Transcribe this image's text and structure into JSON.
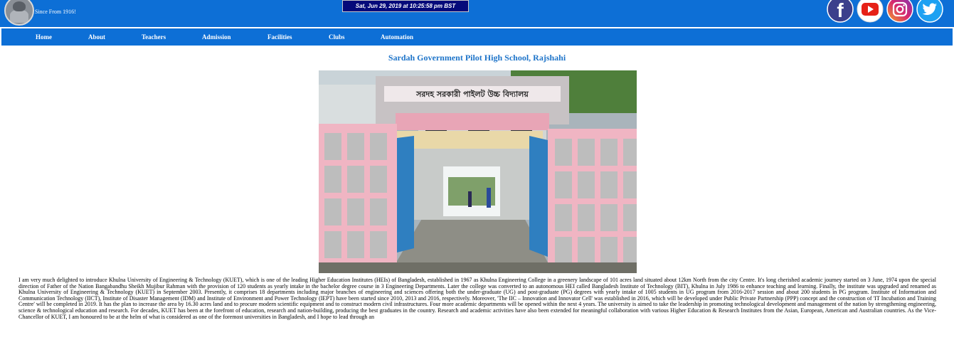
{
  "header": {
    "since": "Since From 1916!",
    "datetime": "Sat, Jun 29, 2019 at 10:25:58 pm BST"
  },
  "social": [
    {
      "name": "facebook-icon",
      "color": "#3b3f8c"
    },
    {
      "name": "youtube-icon",
      "color": "#ffffff"
    },
    {
      "name": "instagram-icon",
      "color": "#c23a8a"
    },
    {
      "name": "twitter-icon",
      "color": "#1da1f2"
    }
  ],
  "nav": {
    "items": [
      "Home",
      "About",
      "Teachers",
      "Admission",
      "Facilities",
      "Clubs",
      "Automation"
    ]
  },
  "main": {
    "title": "Sardah Government Pilot High School, Rajshahi",
    "gate_sign": "সরদহ সরকারী পাইলট উচ্চ বিদ্যালয়",
    "paragraph": "I am very much delighted to introduce Khulna University of Engineering & Technology (KUET), which is one of the leading Higher Education Institutes (HEIs) of Bangladesh, established in 1967 as Khulna Engineering College in a greenery landscape of 101 acres land situated about 12km North from the city Centre. It's long cherished academic journey started on 3 June, 1974 upon the special direction of Father of the Nation Bangabandhu Sheikh Mujibur Rahman with the provision of 120 students as yearly intake in the bachelor degree course in 3 Engineering Departments. Later the college was converted to an autonomous HEI called Bangladesh Institute of Technology (BIT), Khulna in July 1986 to enhance teaching and learning. Finally, the institute was upgraded and renamed as Khulna University of Engineering & Technology (KUET) in September 2003. Presently, it comprises 18 departments including major branches of engineering and sciences offering both the under-graduate (UG) and post-graduate (PG) degrees with yearly intake of 1005 students in UG program from 2016-2017 session and about 200 students in PG program. Institute of Information and Communication Technology (IICT), Institute of Disaster Management (IDM) and Institute of Environment and Power Technology (IEPT) have been started since 2010, 2013 and 2016, respectively. Moreover, 'The IIC – Innovation and Innovator Cell' was established in 2016, which will be developed under Public Private Partnership (PPP) concept and the construction of 'IT Incubation and Training Centre' will be completed in 2019. It has the plan to increase the area by 16.30 acres land and to procure modern scientific equipment and to construct modern civil infrastructures. Four more academic departments will be opened within the next 4 years. The university is aimed to take the leadership in promoting technological development and management of the nation by strengthening engineering, science & technological education and research. For decades, KUET has been at the forefront of education, research and nation-building, producing the best graduates in the country. Research and academic activities have also been extended for meaningful collaboration with various Higher Education & Research Institutes from the Asian, European, American and Australian countries. As the Vice-Chancellor of KUET, I am honoured to be at the helm of what is considered as one of the foremost universities in Bangladesh, and I hope to lead through an"
  }
}
